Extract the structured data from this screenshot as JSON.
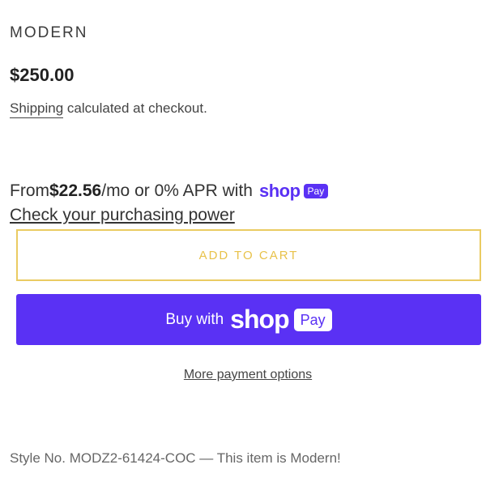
{
  "product": {
    "vendor": "MODERN",
    "price": "$250.00"
  },
  "shipping": {
    "link_text": "Shipping",
    "suffix": " calculated at checkout."
  },
  "installments": {
    "prefix": "From ",
    "amount": "$22.56",
    "suffix": "/mo or 0% APR with",
    "brand_word": "shop",
    "brand_badge": "Pay",
    "link_text": "Check your purchasing power"
  },
  "buttons": {
    "add_to_cart": "ADD TO CART",
    "buy_with_prefix": "Buy with",
    "buy_with_brand": "shop",
    "buy_with_badge": "Pay",
    "more_payment_options": "More payment options"
  },
  "footer": {
    "style_number": "Style No. MODZ2-61424-COC — This item is Modern!"
  },
  "colors": {
    "shop_pay_purple": "#5a31f4",
    "add_to_cart_gold": "#e8c24a"
  }
}
